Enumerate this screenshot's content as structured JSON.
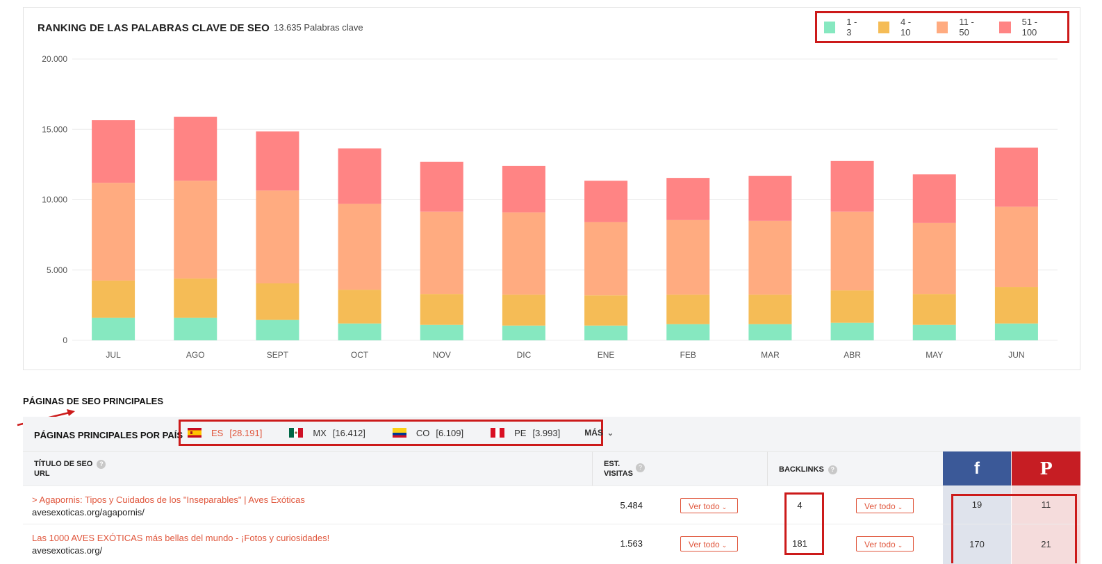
{
  "chart": {
    "title": "RANKING DE LAS PALABRAS CLAVE DE SEO",
    "subtitle": "13.635 Palabras clave"
  },
  "legend": [
    {
      "label": "1 - 3",
      "color": "#86e8c0"
    },
    {
      "label": "4 - 10",
      "color": "#f5bc56"
    },
    {
      "label": "11 - 50",
      "color": "#ffab80"
    },
    {
      "label": "51 - 100",
      "color": "#ff8484"
    }
  ],
  "chart_data": {
    "type": "bar",
    "stacked": true,
    "categories": [
      "JUL",
      "AGO",
      "SEPT",
      "OCT",
      "NOV",
      "DIC",
      "ENE",
      "FEB",
      "MAR",
      "ABR",
      "MAY",
      "JUN"
    ],
    "series": [
      {
        "name": "1 - 3",
        "color": "#86e8c0",
        "values": [
          1600,
          1600,
          1450,
          1200,
          1100,
          1050,
          1050,
          1150,
          1150,
          1250,
          1100,
          1200
        ]
      },
      {
        "name": "4 - 10",
        "color": "#f5bc56",
        "values": [
          2650,
          2800,
          2600,
          2400,
          2200,
          2200,
          2150,
          2100,
          2100,
          2300,
          2200,
          2600
        ]
      },
      {
        "name": "11 - 50",
        "color": "#ffab80",
        "values": [
          6950,
          6950,
          6600,
          6100,
          5850,
          5850,
          5200,
          5300,
          5250,
          5600,
          5050,
          5700
        ]
      },
      {
        "name": "51 - 100",
        "color": "#ff8484",
        "values": [
          4450,
          4550,
          4200,
          3950,
          3550,
          3300,
          2950,
          3000,
          3200,
          3600,
          3450,
          4200
        ]
      }
    ],
    "yticks": [
      "0",
      "5.000",
      "10.000",
      "15.000",
      "20.000"
    ],
    "ylim": [
      0,
      20000
    ],
    "grid": true,
    "legend_position": "top-right"
  },
  "section": {
    "title": "PÁGINAS DE SEO PRINCIPALES"
  },
  "countries": {
    "title": "PÁGINAS PRINCIPALES POR PAÍS",
    "items": [
      {
        "code": "ES",
        "count": "[28.191]",
        "flag": "spain-flag-icon"
      },
      {
        "code": "MX",
        "count": "[16.412]",
        "flag": "mexico-flag-icon"
      },
      {
        "code": "CO",
        "count": "[6.109]",
        "flag": "colombia-flag-icon"
      },
      {
        "code": "PE",
        "count": "[3.993]",
        "flag": "peru-flag-icon"
      }
    ],
    "more": "MÁS"
  },
  "table": {
    "headers": {
      "title_line1": "TÍTULO DE SEO",
      "title_line2": "URL",
      "visits_line1": "EST.",
      "visits_line2": "VISITAS",
      "backlinks": "BACKLINKS",
      "help": "?"
    },
    "social": {
      "facebook": "f",
      "pinterest": "P"
    },
    "button_label": "Ver todo",
    "rows": [
      {
        "title": "> Agapornis: Tipos y Cuidados de los \"Inseparables\" | Aves Exóticas",
        "url": "avesexoticas.org/agapornis/",
        "visits": "5.484",
        "backlinks": "4",
        "facebook": "19",
        "pinterest": "11"
      },
      {
        "title": "Las 1000 AVES EXÓTICAS más bellas del mundo - ¡Fotos y curiosidades!",
        "url": "avesexoticas.org/",
        "visits": "1.563",
        "backlinks": "181",
        "facebook": "170",
        "pinterest": "21"
      }
    ]
  }
}
